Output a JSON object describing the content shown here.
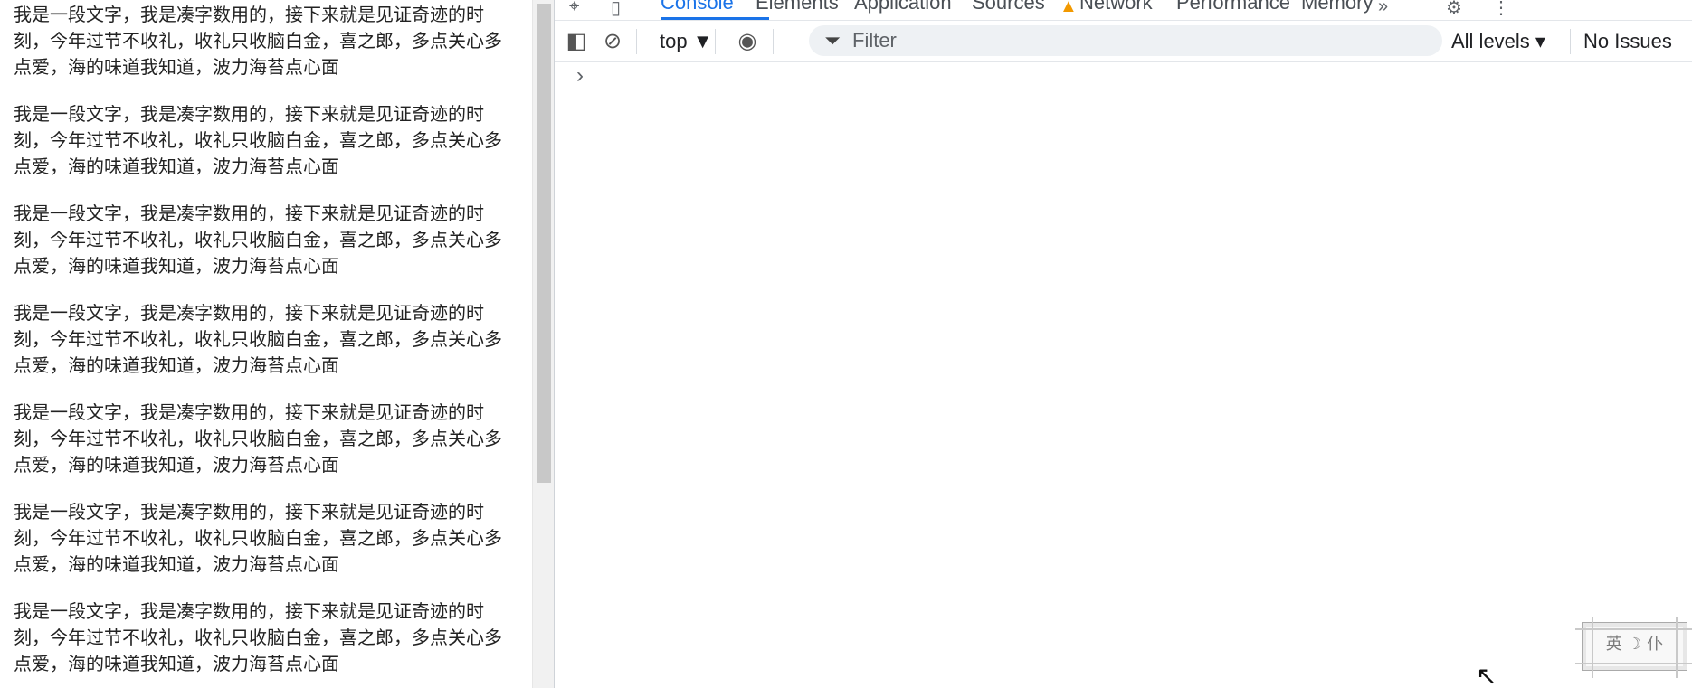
{
  "webpage": {
    "paragraphs": [
      "我是一段文字，我是凑字数用的，接下来就是见证奇迹的时刻，今年过节不收礼，收礼只收脑白金，喜之郎，多点关心多点爱，海的味道我知道，波力海苔点心面",
      "我是一段文字，我是凑字数用的，接下来就是见证奇迹的时刻，今年过节不收礼，收礼只收脑白金，喜之郎，多点关心多点爱，海的味道我知道，波力海苔点心面",
      "我是一段文字，我是凑字数用的，接下来就是见证奇迹的时刻，今年过节不收礼，收礼只收脑白金，喜之郎，多点关心多点爱，海的味道我知道，波力海苔点心面",
      "我是一段文字，我是凑字数用的，接下来就是见证奇迹的时刻，今年过节不收礼，收礼只收脑白金，喜之郎，多点关心多点爱，海的味道我知道，波力海苔点心面",
      "我是一段文字，我是凑字数用的，接下来就是见证奇迹的时刻，今年过节不收礼，收礼只收脑白金，喜之郎，多点关心多点爱，海的味道我知道，波力海苔点心面",
      "我是一段文字，我是凑字数用的，接下来就是见证奇迹的时刻，今年过节不收礼，收礼只收脑白金，喜之郎，多点关心多点爱，海的味道我知道，波力海苔点心面",
      "我是一段文字，我是凑字数用的，接下来就是见证奇迹的时刻，今年过节不收礼，收礼只收脑白金，喜之郎，多点关心多点爱，海的味道我知道，波力海苔点心面"
    ]
  },
  "devtools": {
    "tabs": [
      "Console",
      "Elements",
      "Application",
      "Sources",
      "Network",
      "Performance",
      "Memory"
    ],
    "active_tab": "Console",
    "toolbar": {
      "context": "top ▼",
      "filter_placeholder": "Filter",
      "levels": "All levels ▾",
      "issues": "No Issues"
    },
    "prompt": "›",
    "overflow_icon": "»"
  },
  "ime_toolbar": {
    "label": "英 ☽ 仆"
  },
  "colors": {
    "accent": "#1a73e8",
    "warning": "#f29900",
    "text": "#202124"
  }
}
